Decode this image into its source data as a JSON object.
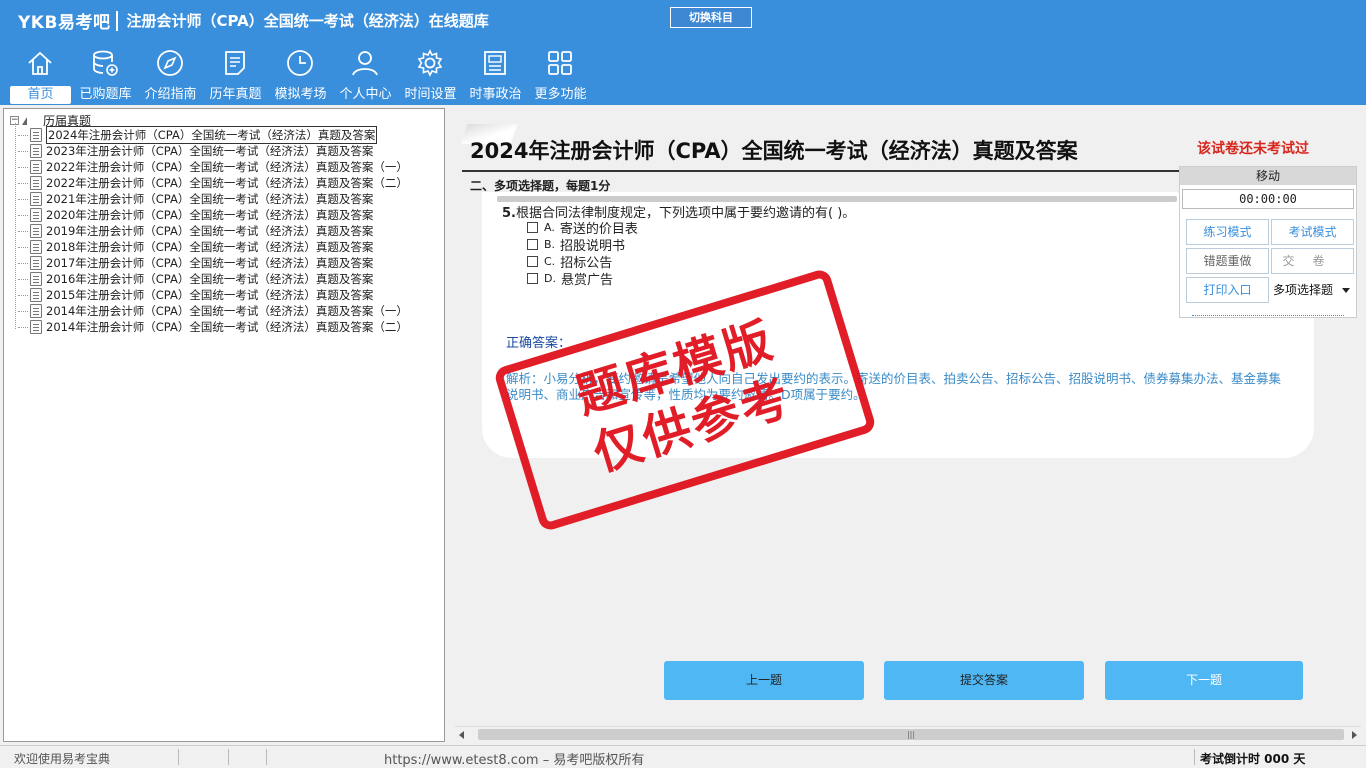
{
  "header": {
    "logo": "YKB易考吧",
    "title": "注册会计师（CPA）全国统一考试（经济法）在线题库",
    "switch_subject": "切换科目"
  },
  "nav": [
    {
      "label": "首页",
      "icon": "home-icon",
      "active": true
    },
    {
      "label": "已购题库",
      "icon": "database-add-icon"
    },
    {
      "label": "介绍指南",
      "icon": "compass-icon"
    },
    {
      "label": "历年真题",
      "icon": "document-list-icon"
    },
    {
      "label": "模拟考场",
      "icon": "clock-icon"
    },
    {
      "label": "个人中心",
      "icon": "user-icon"
    },
    {
      "label": "时间设置",
      "icon": "gear-icon"
    },
    {
      "label": "时事政治",
      "icon": "news-icon"
    },
    {
      "label": "更多功能",
      "icon": "grid-icon"
    }
  ],
  "tree": {
    "root": "历届真题",
    "items": [
      "2024年注册会计师（CPA）全国统一考试（经济法）真题及答案",
      "2023年注册会计师（CPA）全国统一考试（经济法）真题及答案",
      "2022年注册会计师（CPA）全国统一考试（经济法）真题及答案（一）",
      "2022年注册会计师（CPA）全国统一考试（经济法）真题及答案（二）",
      "2021年注册会计师（CPA）全国统一考试（经济法）真题及答案",
      "2020年注册会计师（CPA）全国统一考试（经济法）真题及答案",
      "2019年注册会计师（CPA）全国统一考试（经济法）真题及答案",
      "2018年注册会计师（CPA）全国统一考试（经济法）真题及答案",
      "2017年注册会计师（CPA）全国统一考试（经济法）真题及答案",
      "2016年注册会计师（CPA）全国统一考试（经济法）真题及答案",
      "2015年注册会计师（CPA）全国统一考试（经济法）真题及答案",
      "2014年注册会计师（CPA）全国统一考试（经济法）真题及答案（一）",
      "2014年注册会计师（CPA）全国统一考试（经济法）真题及答案（二）"
    ],
    "selected_index": 0
  },
  "paper": {
    "title": "2024年注册会计师（CPA）全国统一考试（经济法）真题及答案",
    "status": "该试卷还未考试过",
    "section": "二、多项选择题，每题1分"
  },
  "question": {
    "number": "5.",
    "text": "根据合同法律制度规定，下列选项中属于要约邀请的有( )。",
    "options": [
      {
        "letter": "A.",
        "text": "寄送的价目表"
      },
      {
        "letter": "B.",
        "text": "招股说明书"
      },
      {
        "letter": "C.",
        "text": "招标公告"
      },
      {
        "letter": "D.",
        "text": "悬赏广告"
      }
    ],
    "answer_label": "正确答案：",
    "analysis": "解析：小易分析，要约邀请是希望他人向自己发出要约的表示。寄送的价目表、拍卖公告、招标公告、招股说明书、债券募集办法、基金募集说明书、商业广告和宣传等，性质均为要约邀请。D项属于要约。"
  },
  "stamp": {
    "line1": "题库模版",
    "line2": "仅供参考"
  },
  "control": {
    "move": "移动",
    "timer": "00:00:00",
    "practice_mode": "练习模式",
    "exam_mode": "考试模式",
    "redo_wrong": "错题重做",
    "submit_paper": "交卷",
    "print": "打印入口",
    "question_type": "多项选择题"
  },
  "buttons": {
    "prev": "上一题",
    "submit": "提交答案",
    "next": "下一题"
  },
  "status_bar": {
    "welcome": "欢迎使用易考宝典",
    "copyright": "https://www.etest8.com – 易考吧版权所有",
    "countdown": "考试倒计时 000 天"
  },
  "colors": {
    "header_bg": "#3a8fdc",
    "button_bg": "#4fb8f4",
    "stamp_red": "#e0121d",
    "status_red": "#d9261c"
  }
}
